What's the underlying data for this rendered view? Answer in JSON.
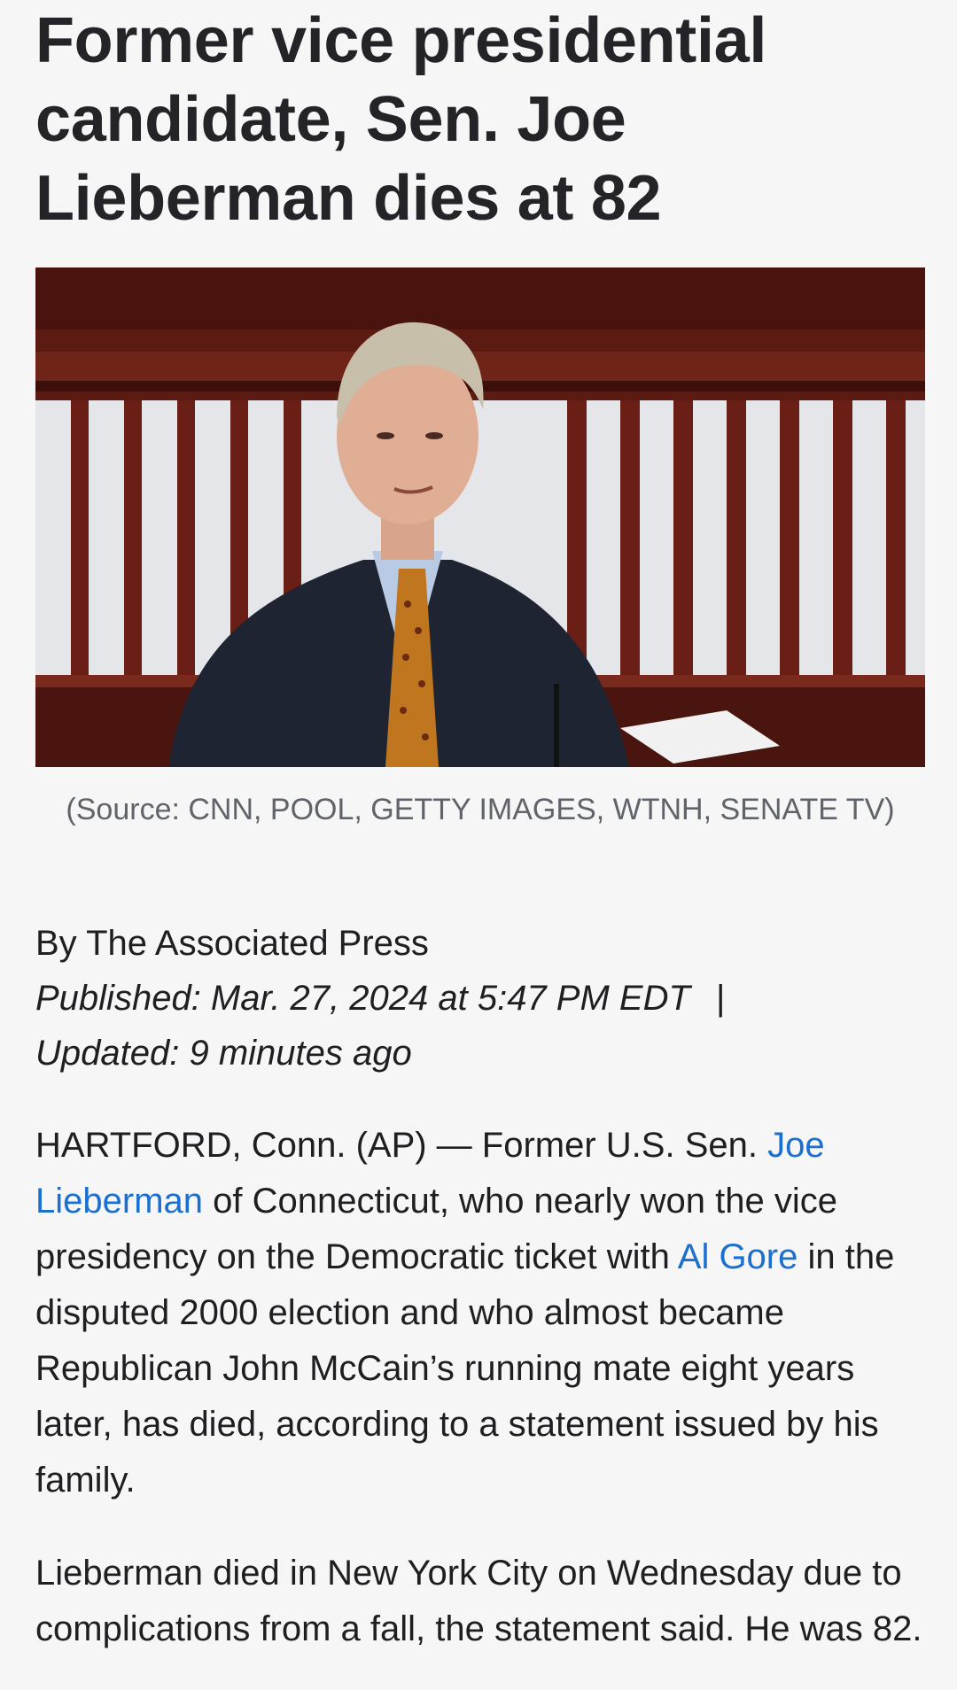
{
  "article": {
    "headline": "Former vice presidential candidate, Sen. Joe Lieberman dies at 82",
    "photo_caption": "(Source: CNN, POOL, GETTY IMAGES, WTNH, SENATE TV)",
    "byline": "By The Associated Press",
    "published_label": "Published:",
    "published_value": " Mar. 27, 2024 at 5:47 PM EDT",
    "separator": "|",
    "updated_label": "Updated:",
    "updated_value": " 9 minutes ago",
    "paragraph1": {
      "part1": "HARTFORD, Conn. (AP) — Former U.S. Sen. ",
      "link1": "Joe Lieberman",
      "part2": " of Connecticut, who nearly won the vice presidency on the Democratic ticket with ",
      "link2": "Al Gore",
      "part3": " in the disputed 2000 election and who almost became Republican John McCain’s running mate eight years later, has died, according to a statement issued by his family."
    },
    "paragraph2": "Lieberman died in New York City on Wednesday due to complications from a fall, the statement said. He was 82."
  },
  "colors": {
    "background": "#f6f6f7",
    "text": "#1f1f22",
    "link": "#1a6fcf",
    "caption": "#60646a"
  }
}
